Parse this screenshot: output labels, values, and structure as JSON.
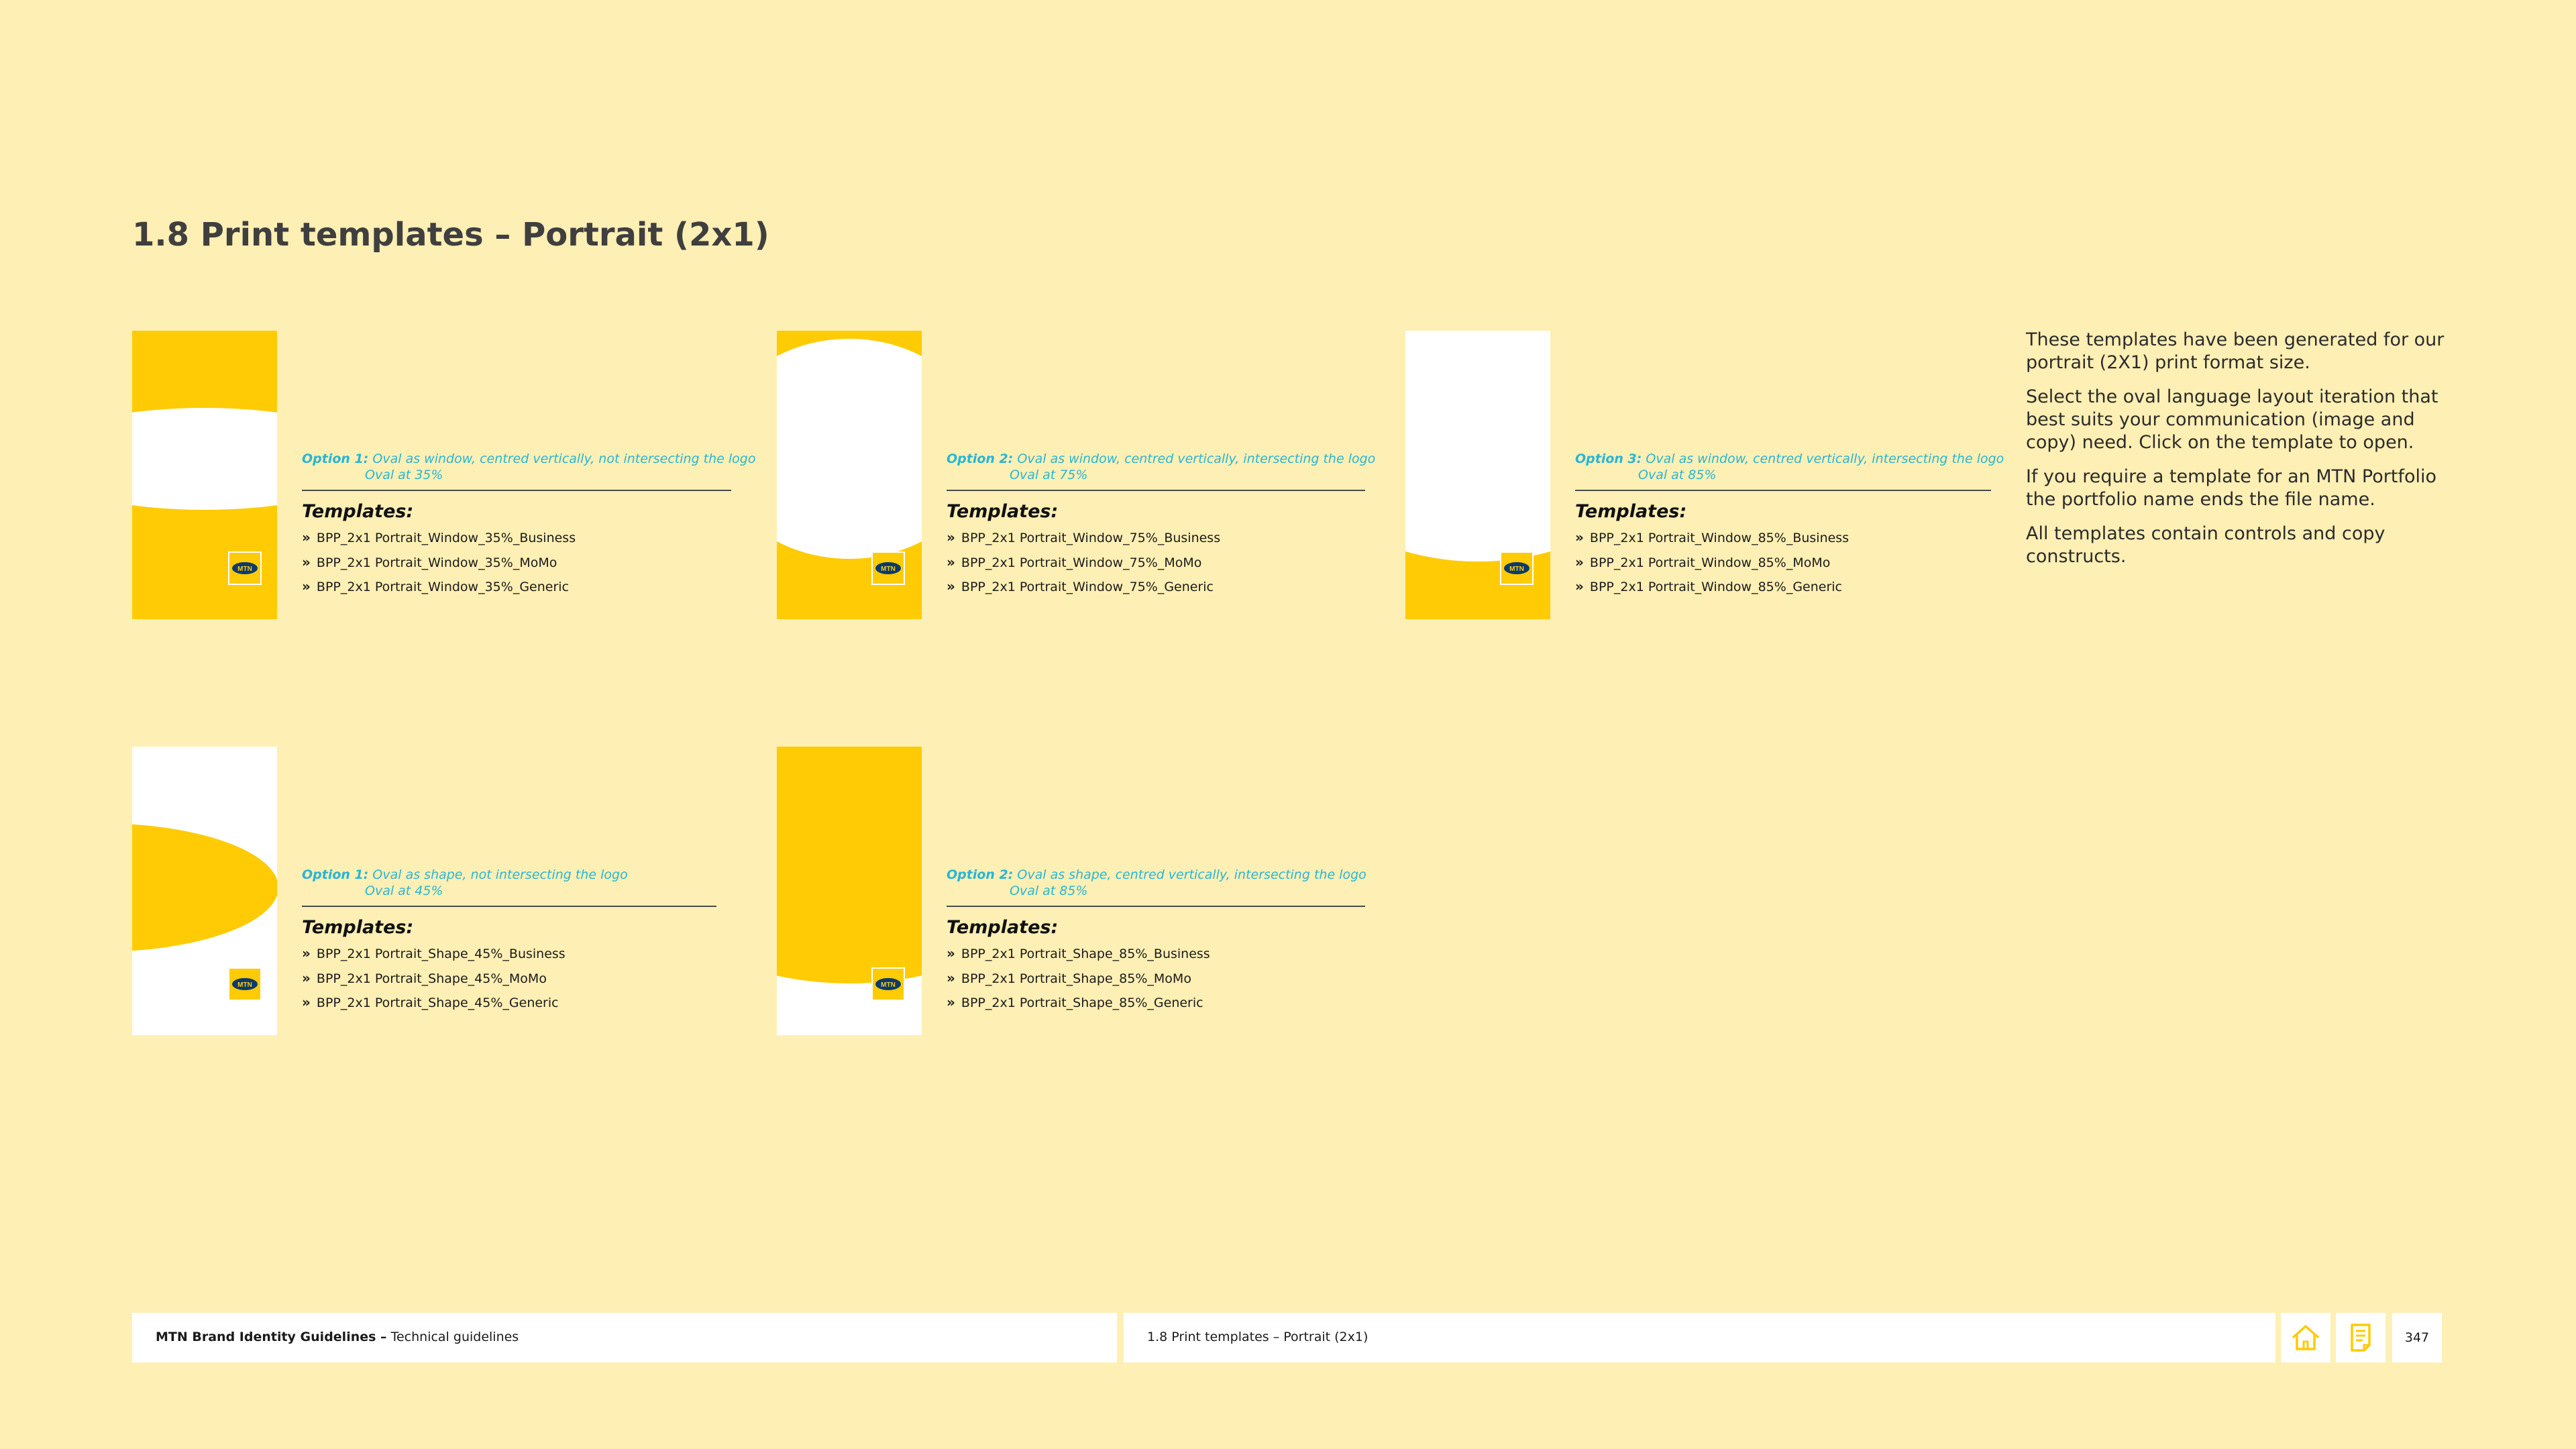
{
  "page": {
    "title": "1.8 Print templates – Portrait (2x1)"
  },
  "colors": {
    "background": "#FEEFB4",
    "mtn_yellow": "#FFCB05",
    "option_cyan": "#27B6D4",
    "logo_blue": "#0B3A6E"
  },
  "cards": [
    {
      "option_label": "Option 1:",
      "option_line1": "Oval as window, centred vertically, not intersecting the logo",
      "option_line2": "Oval at 35%",
      "templates_heading": "Templates:",
      "templates": [
        "BPP_2x1 Portrait_Window_35%_Business",
        "BPP_2x1 Portrait_Window_35%_MoMo",
        "BPP_2x1 Portrait_Window_35%_Generic"
      ],
      "logo_text": "MTN"
    },
    {
      "option_label": "Option 2:",
      "option_line1": "Oval as window, centred vertically, intersecting the logo",
      "option_line2": "Oval at 75%",
      "templates_heading": "Templates:",
      "templates": [
        "BPP_2x1 Portrait_Window_75%_Business",
        "BPP_2x1 Portrait_Window_75%_MoMo",
        "BPP_2x1 Portrait_Window_75%_Generic"
      ],
      "logo_text": "MTN"
    },
    {
      "option_label": "Option 3:",
      "option_line1": "Oval as window, centred vertically, intersecting the logo",
      "option_line2": "Oval at 85%",
      "templates_heading": "Templates:",
      "templates": [
        "BPP_2x1 Portrait_Window_85%_Business",
        "BPP_2x1 Portrait_Window_85%_MoMo",
        "BPP_2x1 Portrait_Window_85%_Generic"
      ],
      "logo_text": "MTN"
    },
    {
      "option_label": "Option 1:",
      "option_line1": "Oval as shape, not intersecting the logo",
      "option_line2": "Oval at 45%",
      "templates_heading": "Templates:",
      "templates": [
        "BPP_2x1 Portrait_Shape_45%_Business",
        "BPP_2x1 Portrait_Shape_45%_MoMo",
        "BPP_2x1 Portrait_Shape_45%_Generic"
      ],
      "logo_text": "MTN"
    },
    {
      "option_label": "Option 2:",
      "option_line1": "Oval as shape, centred vertically, intersecting the logo",
      "option_line2": "Oval at 85%",
      "templates_heading": "Templates:",
      "templates": [
        "BPP_2x1 Portrait_Shape_85%_Business",
        "BPP_2x1 Portrait_Shape_85%_MoMo",
        "BPP_2x1 Portrait_Shape_85%_Generic"
      ],
      "logo_text": "MTN"
    }
  ],
  "sidebar_text": {
    "p1": "These templates have been generated for our portrait (2X1) print format size.",
    "p2": "Select the oval language layout iteration that best suits your communication (image and copy) need. Click on the template to open.",
    "p3": "If you require a template for an MTN Portfolio the portfolio name ends the file name.",
    "p4": "All templates contain controls and copy constructs."
  },
  "footer": {
    "doc_title": "MTN Brand Identity Guidelines –",
    "doc_subtitle": "Technical guidelines",
    "section": "1.8 Print templates – Portrait (2x1)",
    "home_icon": "home-icon",
    "contents_icon": "document-list-icon",
    "page_number": "347"
  }
}
